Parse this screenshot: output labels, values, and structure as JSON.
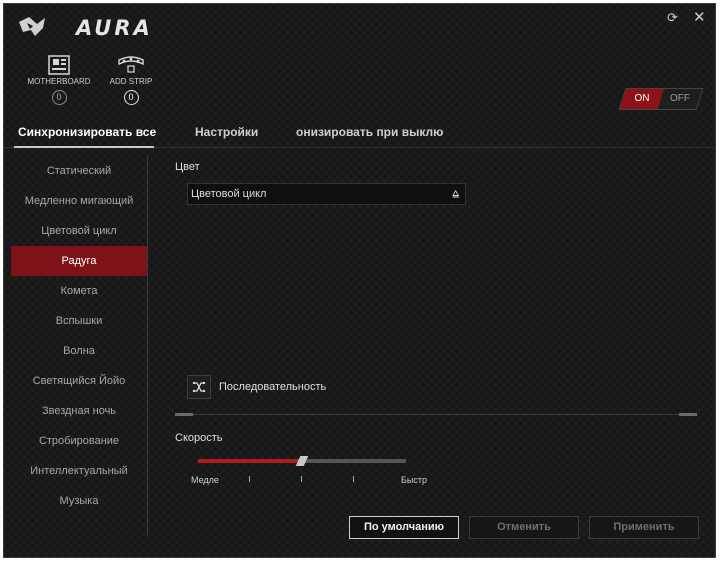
{
  "app": {
    "title": "AURA"
  },
  "devices": [
    {
      "label": "MOTHERBOARD",
      "badge": "0",
      "icon": "motherboard-icon"
    },
    {
      "label": "ADD STRIP",
      "badge": "0",
      "icon": "led-strip-icon"
    }
  ],
  "power_toggle": {
    "on_label": "ON",
    "off_label": "OFF",
    "state": "on"
  },
  "tabs": [
    {
      "label": "Синхронизировать все",
      "active": true
    },
    {
      "label": "Настройки",
      "active": false
    },
    {
      "label": "онизировать при выклю",
      "active": false
    }
  ],
  "sidebar": {
    "items": [
      {
        "label": "Статический"
      },
      {
        "label": "Медленно мигающий"
      },
      {
        "label": "Цветовой цикл"
      },
      {
        "label": "Радуга",
        "active": true
      },
      {
        "label": "Комета"
      },
      {
        "label": "Вспышки"
      },
      {
        "label": "Волна"
      },
      {
        "label": "Светящийся Йойо"
      },
      {
        "label": "Звездная ночь"
      },
      {
        "label": "Стробирование"
      },
      {
        "label": "Интеллектуальный"
      },
      {
        "label": "Музыка"
      }
    ]
  },
  "main": {
    "color_label": "Цвет",
    "color_select_value": "Цветовой цикл",
    "sequence_label": "Последовательность",
    "speed_label": "Скорость",
    "speed_min_label": "Медле",
    "speed_max_label": "Быстр",
    "speed_value": 0.5
  },
  "buttons": {
    "default": "По умолчанию",
    "cancel": "Отменить",
    "apply": "Применить"
  },
  "colors": {
    "accent": "#8e1319",
    "background": "#171717"
  }
}
